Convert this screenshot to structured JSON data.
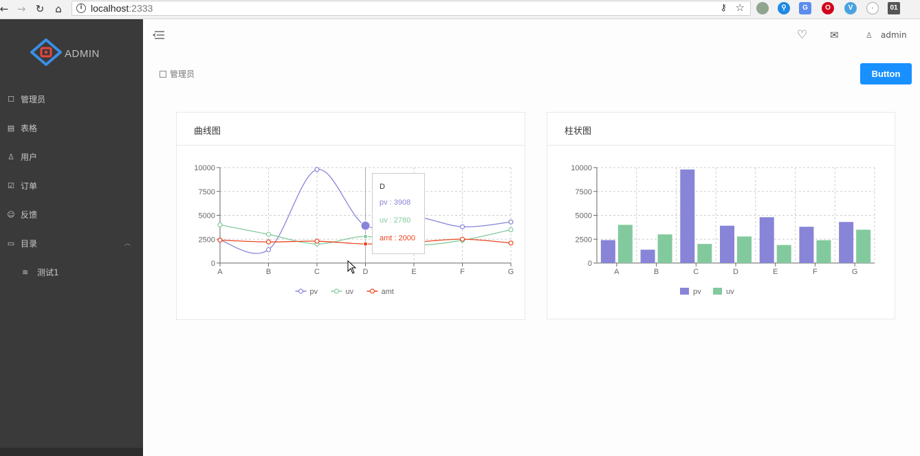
{
  "browser": {
    "url_host": "localhost",
    "url_port": ":2333",
    "back_icon": "arrow-left-icon",
    "forward_icon": "arrow-right-icon",
    "reload_icon": "reload-icon",
    "home_icon": "home-icon",
    "ext_labels": [
      "",
      "",
      "",
      "",
      "",
      "",
      "01"
    ]
  },
  "sidebar": {
    "logo_text": "ADMIN",
    "items": [
      {
        "icon": "book-icon",
        "glyph": "☐",
        "label": "管理员"
      },
      {
        "icon": "table-icon",
        "glyph": "▤",
        "label": "表格"
      },
      {
        "icon": "user-icon",
        "glyph": "♙",
        "label": "用户"
      },
      {
        "icon": "order-icon",
        "glyph": "☑",
        "label": "订单"
      },
      {
        "icon": "feedback-icon",
        "glyph": "☺",
        "label": "反馈"
      },
      {
        "icon": "folder-icon",
        "glyph": "▭",
        "label": "目录"
      }
    ],
    "submenu": [
      {
        "icon": "wifi-icon",
        "glyph": "≋",
        "label": "测试1"
      }
    ]
  },
  "header": {
    "user_name": "admin"
  },
  "breadcrumb": {
    "label": "管理员"
  },
  "toolbar": {
    "button_label": "Button"
  },
  "colors": {
    "pv": "#8884d8",
    "uv": "#82ca9d",
    "amt": "#e8451e",
    "primary": "#1890ff"
  },
  "line_card": {
    "title": "曲线图"
  },
  "bar_card": {
    "title": "柱状图"
  },
  "tooltip": {
    "label": "D",
    "rows": [
      "pv : 3908",
      "uv : 2780",
      "amt : 2000"
    ]
  },
  "chart_data": [
    {
      "type": "line",
      "title": "曲线图",
      "categories": [
        "A",
        "B",
        "C",
        "D",
        "E",
        "F",
        "G"
      ],
      "ylim": [
        0,
        10000
      ],
      "yticks": [
        0,
        2500,
        5000,
        7500,
        10000
      ],
      "grid": true,
      "legend": "bottom-center",
      "series": [
        {
          "name": "pv",
          "values": [
            2400,
            1398,
            9800,
            3908,
            4800,
            3800,
            4300
          ]
        },
        {
          "name": "uv",
          "values": [
            4000,
            3000,
            2000,
            2780,
            1890,
            2390,
            3490
          ]
        },
        {
          "name": "amt",
          "values": [
            2400,
            2210,
            2290,
            2000,
            2181,
            2500,
            2100
          ]
        }
      ]
    },
    {
      "type": "bar",
      "title": "柱状图",
      "categories": [
        "A",
        "B",
        "C",
        "D",
        "E",
        "F",
        "G"
      ],
      "ylim": [
        0,
        10000
      ],
      "yticks": [
        0,
        2500,
        5000,
        7500,
        10000
      ],
      "grid": true,
      "legend": "bottom-center",
      "series": [
        {
          "name": "pv",
          "values": [
            2400,
            1398,
            9800,
            3908,
            4800,
            3800,
            4300
          ]
        },
        {
          "name": "uv",
          "values": [
            4000,
            3000,
            2000,
            2780,
            1890,
            2390,
            3490
          ]
        }
      ]
    }
  ]
}
